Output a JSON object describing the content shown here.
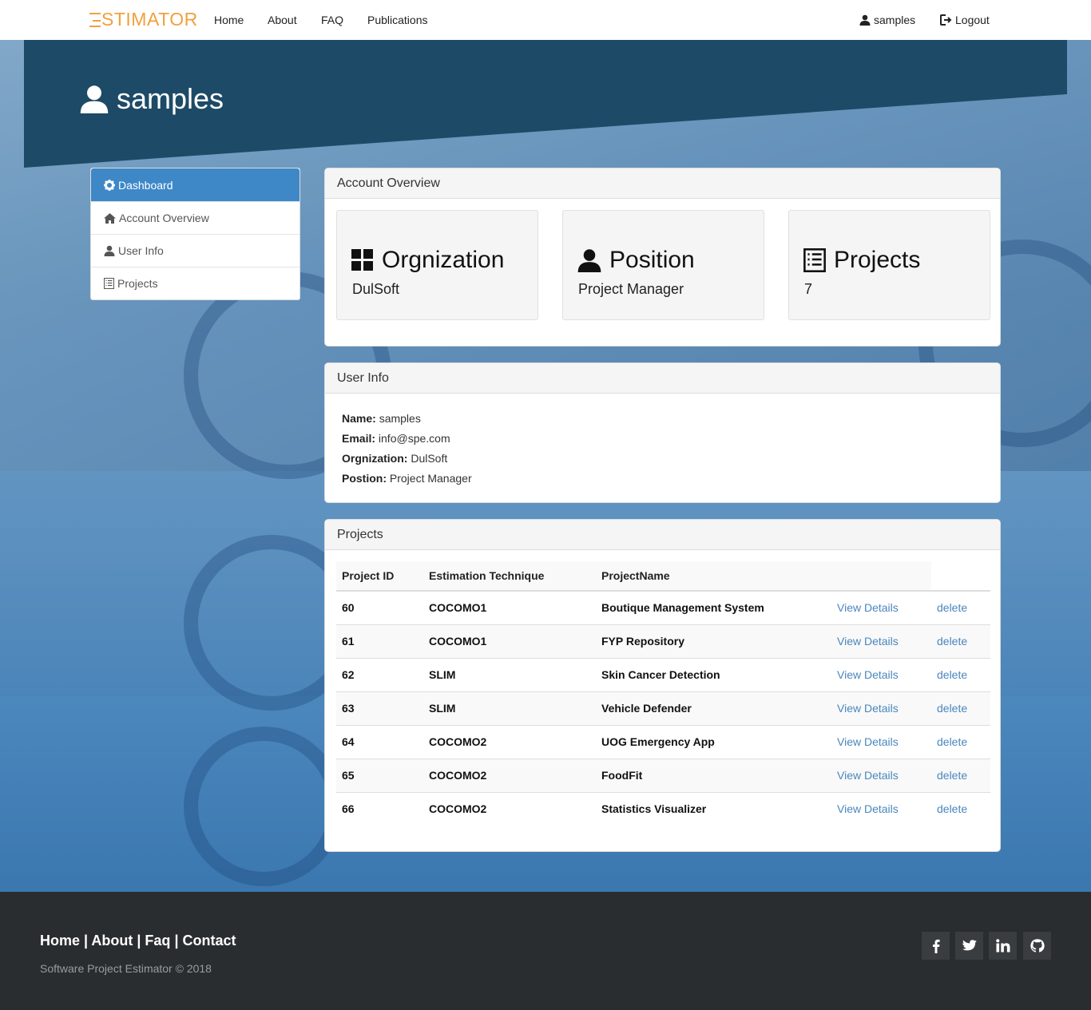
{
  "navbar": {
    "brand": "STIMATOR",
    "links": [
      "Home",
      "About",
      "FAQ",
      "Publications"
    ],
    "user": "samples",
    "logout": "Logout"
  },
  "hero": {
    "title": "samples"
  },
  "sidebar": {
    "items": [
      {
        "label": "Dashboard",
        "icon": "gear-icon"
      },
      {
        "label": "Account Overview",
        "icon": "home-icon"
      },
      {
        "label": "User Info",
        "icon": "user-icon"
      },
      {
        "label": "Projects",
        "icon": "list-icon"
      }
    ]
  },
  "account_overview": {
    "title": "Account Overview",
    "cards": [
      {
        "title": "Orgnization",
        "value": "DulSoft",
        "icon": "grid-icon"
      },
      {
        "title": "Position",
        "value": "Project Manager",
        "icon": "user-icon"
      },
      {
        "title": "Projects",
        "value": "7",
        "icon": "list-icon"
      }
    ]
  },
  "user_info": {
    "title": "User Info",
    "rows": [
      {
        "label": "Name:",
        "value": "samples"
      },
      {
        "label": "Email:",
        "value": "info@spe.com"
      },
      {
        "label": "Orgnization:",
        "value": "DulSoft"
      },
      {
        "label": "Postion:",
        "value": "Project Manager"
      }
    ]
  },
  "projects": {
    "title": "Projects",
    "columns": [
      "Project ID",
      "Estimation Technique",
      "ProjectName"
    ],
    "view_label": "View Details",
    "delete_label": "delete",
    "rows": [
      {
        "id": "60",
        "technique": "COCOMO1",
        "name": "Boutique Management System"
      },
      {
        "id": "61",
        "technique": "COCOMO1",
        "name": "FYP Repository"
      },
      {
        "id": "62",
        "technique": "SLIM",
        "name": "Skin Cancer Detection"
      },
      {
        "id": "63",
        "technique": "SLIM",
        "name": "Vehicle Defender"
      },
      {
        "id": "64",
        "technique": "COCOMO2",
        "name": "UOG Emergency App"
      },
      {
        "id": "65",
        "technique": "COCOMO2",
        "name": "FoodFit"
      },
      {
        "id": "66",
        "technique": "COCOMO2",
        "name": "Statistics Visualizer"
      }
    ]
  },
  "footer": {
    "links": [
      "Home",
      "About",
      "Faq",
      "Contact"
    ],
    "separator": " | ",
    "copyright": "Software Project Estimator © 2018",
    "social": [
      {
        "icon": "facebook-icon",
        "glyph": "f"
      },
      {
        "icon": "twitter-icon",
        "glyph": "t"
      },
      {
        "icon": "linkedin-icon",
        "glyph": "in"
      },
      {
        "icon": "github-icon",
        "glyph": "gh"
      }
    ]
  },
  "colors": {
    "brand": "#f2a03d",
    "hero": "#1d4a66",
    "active": "#3e88c8",
    "link": "#4a86bd",
    "footer": "#2a2d30"
  }
}
